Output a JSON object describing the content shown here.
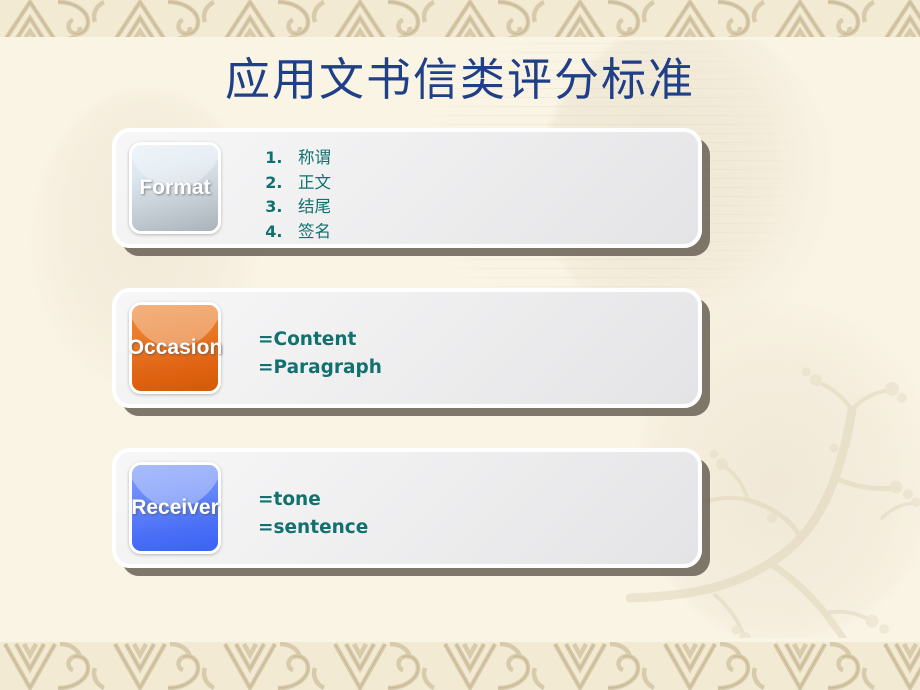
{
  "slide": {
    "title": "应用文书信类评分标准",
    "title_color": "#1f3f87",
    "background_color": "#faf4e5",
    "accent_text_color": "#10716e"
  },
  "panels": [
    {
      "tile_label": "Format",
      "tile_color": "#c4ccd3",
      "tile_icon": "format-tile-icon",
      "list": [
        {
          "num": "1.",
          "text": "称谓"
        },
        {
          "num": "2.",
          "text": "正文"
        },
        {
          "num": "3.",
          "text": "结尾"
        },
        {
          "num": "4.",
          "text": "签名"
        }
      ]
    },
    {
      "tile_label": "Occasion",
      "tile_color": "#e07015",
      "tile_icon": "occasion-tile-icon",
      "lines": [
        "=Content",
        "=Paragraph"
      ]
    },
    {
      "tile_label": "Receiver",
      "tile_color": "#4a6ff6",
      "tile_icon": "receiver-tile-icon",
      "lines": [
        "=tone",
        "=sentence"
      ]
    }
  ],
  "decor": {
    "top_band": "chinese-meander-pattern",
    "bottom_band": "chinese-meander-pattern",
    "watermark": "plum-blossom-branch"
  }
}
